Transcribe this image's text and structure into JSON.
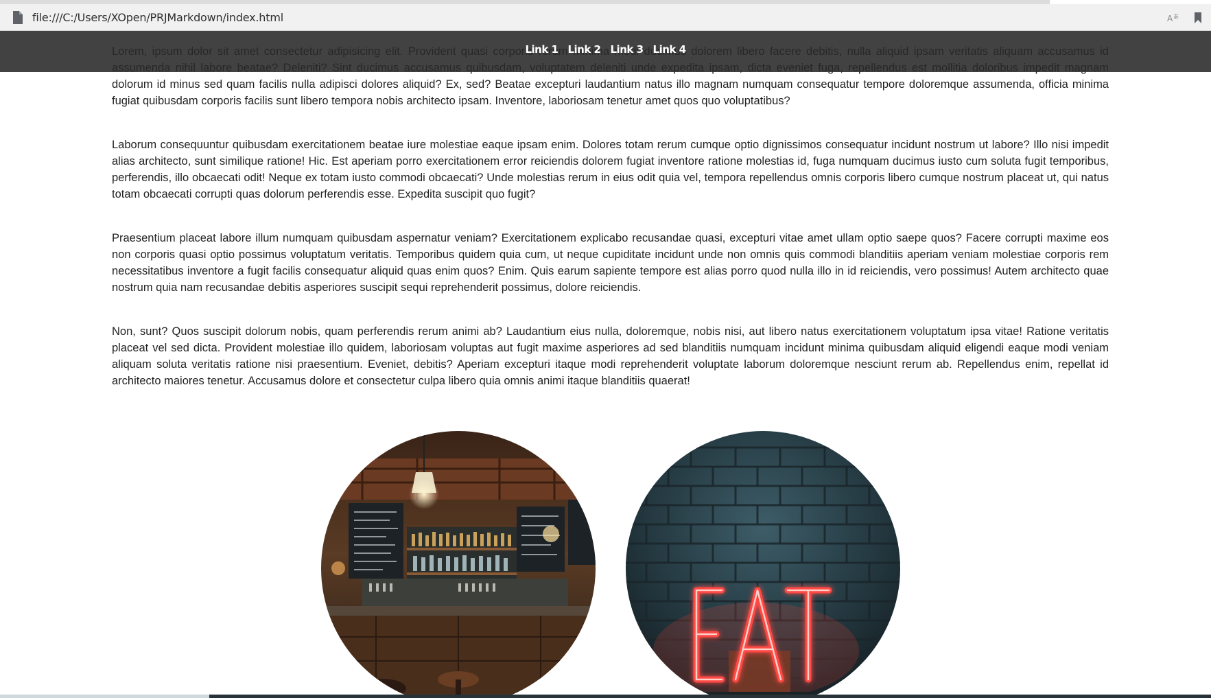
{
  "browser": {
    "url": "file:///C:/Users/XOpen/PRJMarkdown/index.html",
    "icons": [
      "page-icon",
      "read-aloud-icon",
      "bookmark-icon"
    ]
  },
  "nav": {
    "links": [
      "Link 1",
      "Link 2",
      "Link 3",
      "Link 4"
    ]
  },
  "paragraphs": [
    "Lorem, ipsum dolor sit amet consectetur adipisicing elit. Provident quasi corporis rerum minima modi ducimus dolorem libero facere debitis, nulla aliquid ipsam veritatis aliquam accusamus id assumenda nihil labore beatae? Deleniti? Sint ducimus accusamus quibusdam, voluptatem deleniti unde expedita ipsam, dicta eveniet fuga, repellendus est mollitia doloribus impedit magnam dolorum id minus sed quam facilis nulla adipisci dolores aliquid? Ex, sed? Beatae excepturi laudantium natus illo magnam numquam consequatur tempore doloremque assumenda, officia minima fugiat quibusdam corporis facilis sunt libero tempora nobis architecto ipsam. Inventore, laboriosam tenetur amet quos quo voluptatibus?",
    "Laborum consequuntur quibusdam exercitationem beatae iure molestiae eaque ipsam enim. Dolores totam rerum cumque optio dignissimos consequatur incidunt nostrum ut labore? Illo nisi impedit alias architecto, sunt similique ratione! Hic. Est aperiam porro exercitationem error reiciendis dolorem fugiat inventore ratione molestias id, fuga numquam ducimus iusto cum soluta fugit temporibus, perferendis, illo obcaecati odit! Neque ex totam iusto commodi obcaecati? Unde molestias rerum in eius odit quia vel, tempora repellendus omnis corporis libero cumque nostrum placeat ut, qui natus totam obcaecati corrupti quas dolorum perferendis esse. Expedita suscipit quo fugit?",
    "Praesentium placeat labore illum numquam quibusdam aspernatur veniam? Exercitationem explicabo recusandae quasi, excepturi vitae amet ullam optio saepe quos? Facere corrupti maxime eos non corporis quasi optio possimus voluptatum veritatis. Temporibus quidem quia cum, ut neque cupiditate incidunt unde non omnis quis commodi blanditiis aperiam veniam molestiae corporis rem necessitatibus inventore a fugit facilis consequatur aliquid quas enim quos? Enim. Quis earum sapiente tempore est alias porro quod nulla illo in id reiciendis, vero possimus! Autem architecto quae nostrum quia nam recusandae debitis asperiores suscipit sequi reprehenderit possimus, dolore reiciendis.",
    "Non, sunt? Quos suscipit dolorum nobis, quam perferendis rerum animi ab? Laudantium eius nulla, doloremque, nobis nisi, aut libero natus exercitationem voluptatum ipsa vitae! Ratione veritatis placeat vel sed dicta. Provident molestiae illo quidem, laboriosam voluptas aut fugit maxime asperiores ad sed blanditiis numquam incidunt minima quibusdam aliquid eligendi eaque modi veniam aliquam soluta veritatis ratione nisi praesentium. Eveniet, debitis? Aperiam excepturi itaque modi reprehenderit voluptate laborum doloremque nesciunt rerum ab. Repellendus enim, repellat id architecto maiores tenetur. Accusamus dolore et consectetur culpa libero quia omnis animi itaque blanditiis quaerat!"
  ],
  "images": {
    "left": "bar-interior-photo",
    "right": "neon-eat-sign-photo",
    "right_sign_text": "EAT"
  },
  "colors": {
    "nav_bg": "#282828",
    "neon": "#ff3b3b",
    "text": "#222222"
  }
}
